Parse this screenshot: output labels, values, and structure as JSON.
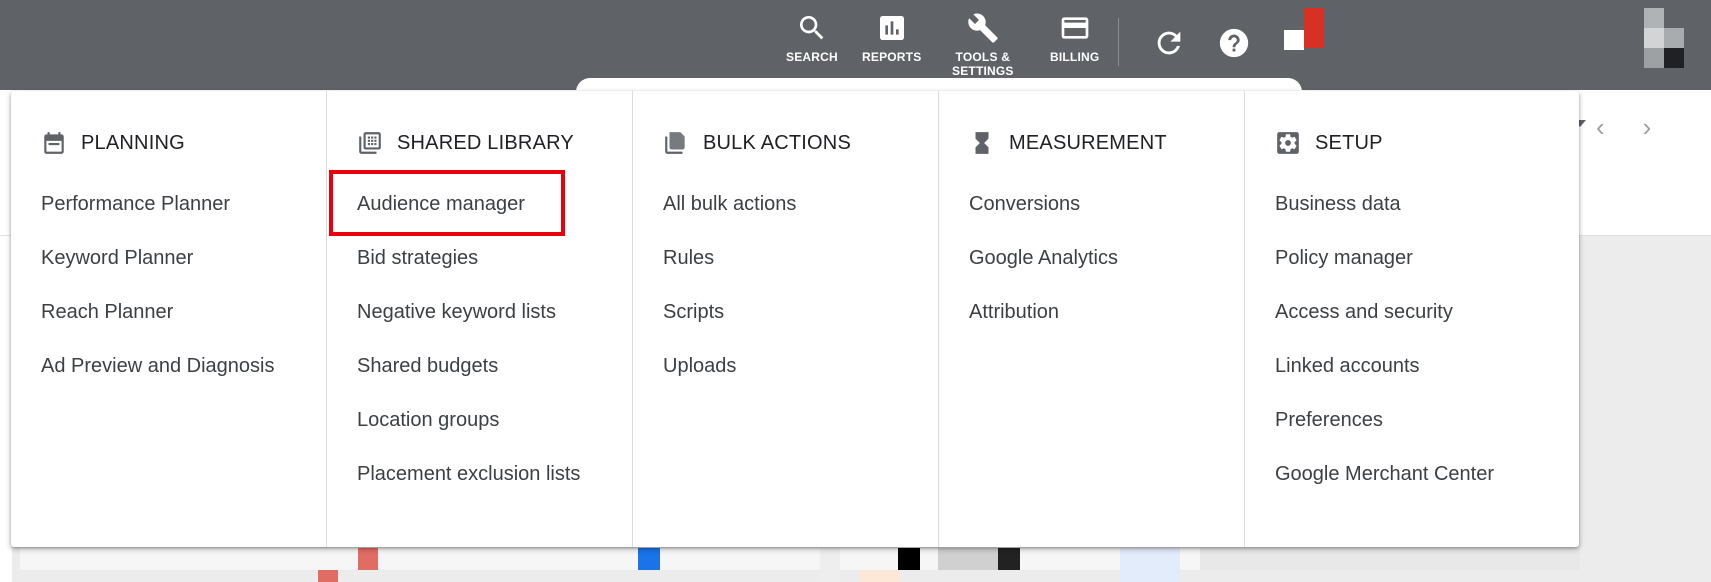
{
  "topbar": {
    "buttons": [
      {
        "label": "SEARCH",
        "icon": "search-icon"
      },
      {
        "label": "REPORTS",
        "icon": "reports-icon"
      },
      {
        "label": "TOOLS &\nSETTINGS",
        "icon": "wrench-icon"
      },
      {
        "label": "BILLING",
        "icon": "credit-card-icon"
      }
    ],
    "refresh_icon": "refresh-icon",
    "help_icon": "help-icon"
  },
  "menu": {
    "columns": [
      {
        "title": "PLANNING",
        "icon": "calendar-icon",
        "items": [
          "Performance Planner",
          "Keyword Planner",
          "Reach Planner",
          "Ad Preview and Diagnosis"
        ]
      },
      {
        "title": "SHARED LIBRARY",
        "icon": "library-icon",
        "items": [
          "Audience manager",
          "Bid strategies",
          "Negative keyword lists",
          "Shared budgets",
          "Location groups",
          "Placement exclusion lists"
        ]
      },
      {
        "title": "BULK ACTIONS",
        "icon": "copy-icon",
        "items": [
          "All bulk actions",
          "Rules",
          "Scripts",
          "Uploads"
        ]
      },
      {
        "title": "MEASUREMENT",
        "icon": "hourglass-icon",
        "items": [
          "Conversions",
          "Google Analytics",
          "Attribution"
        ]
      },
      {
        "title": "SETUP",
        "icon": "settings-icon",
        "items": [
          "Business data",
          "Policy manager",
          "Access and security",
          "Linked accounts",
          "Preferences",
          "Google Merchant Center"
        ]
      }
    ],
    "highlighted_item": "Audience manager"
  },
  "colors": {
    "topbar": "#5f6368",
    "highlight": "#e8000b",
    "flag_red": "#d93025"
  }
}
